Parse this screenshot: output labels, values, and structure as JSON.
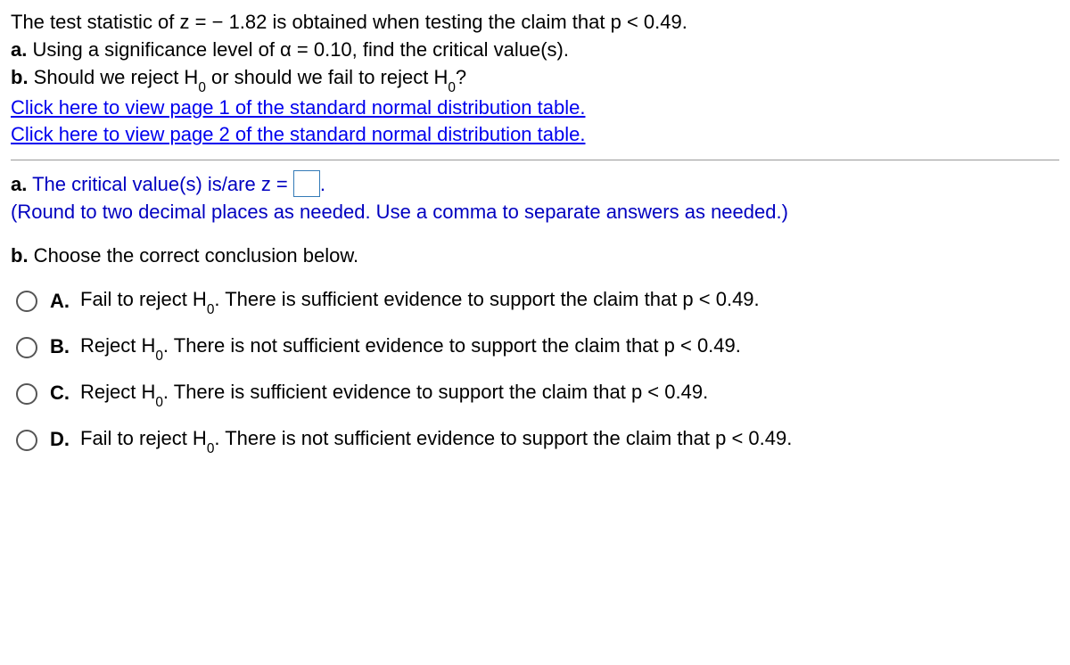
{
  "intro": {
    "line1a": "The test statistic of z = ",
    "line1b": " 1.82 is obtained when testing the claim that p < 0.49.",
    "minus": "−",
    "line2_label": "a.",
    "line2_text": " Using a significance level of α = 0.10, find the critical value(s).",
    "line3_label": "b.",
    "line3_a": " Should we reject H",
    "line3_b": " or should we fail to reject H",
    "line3_c": "?",
    "sub0": "0"
  },
  "links": {
    "page1": "Click here to view page 1 of the standard normal distribution table.",
    "page2": "Click here to view page 2 of the standard normal distribution table."
  },
  "part_a": {
    "label": "a.",
    "text_before": " The critical value(s) is/are z = ",
    "text_after": ".",
    "hint": "(Round to two decimal places as needed. Use a comma to separate answers as needed.)"
  },
  "part_b": {
    "label": "b.",
    "text": " Choose the correct conclusion below."
  },
  "choices": [
    {
      "letter": "A.",
      "pre": "Fail to reject H",
      "post": ". There is sufficient evidence to support the claim that p < 0.49."
    },
    {
      "letter": "B.",
      "pre": "Reject H",
      "post": ". There is not sufficient evidence to support the claim that p < 0.49."
    },
    {
      "letter": "C.",
      "pre": "Reject H",
      "post": ". There is sufficient evidence to support the claim that p < 0.49."
    },
    {
      "letter": "D.",
      "pre": "Fail to reject H",
      "post": ". There is not sufficient evidence to support the claim that p < 0.49."
    }
  ]
}
